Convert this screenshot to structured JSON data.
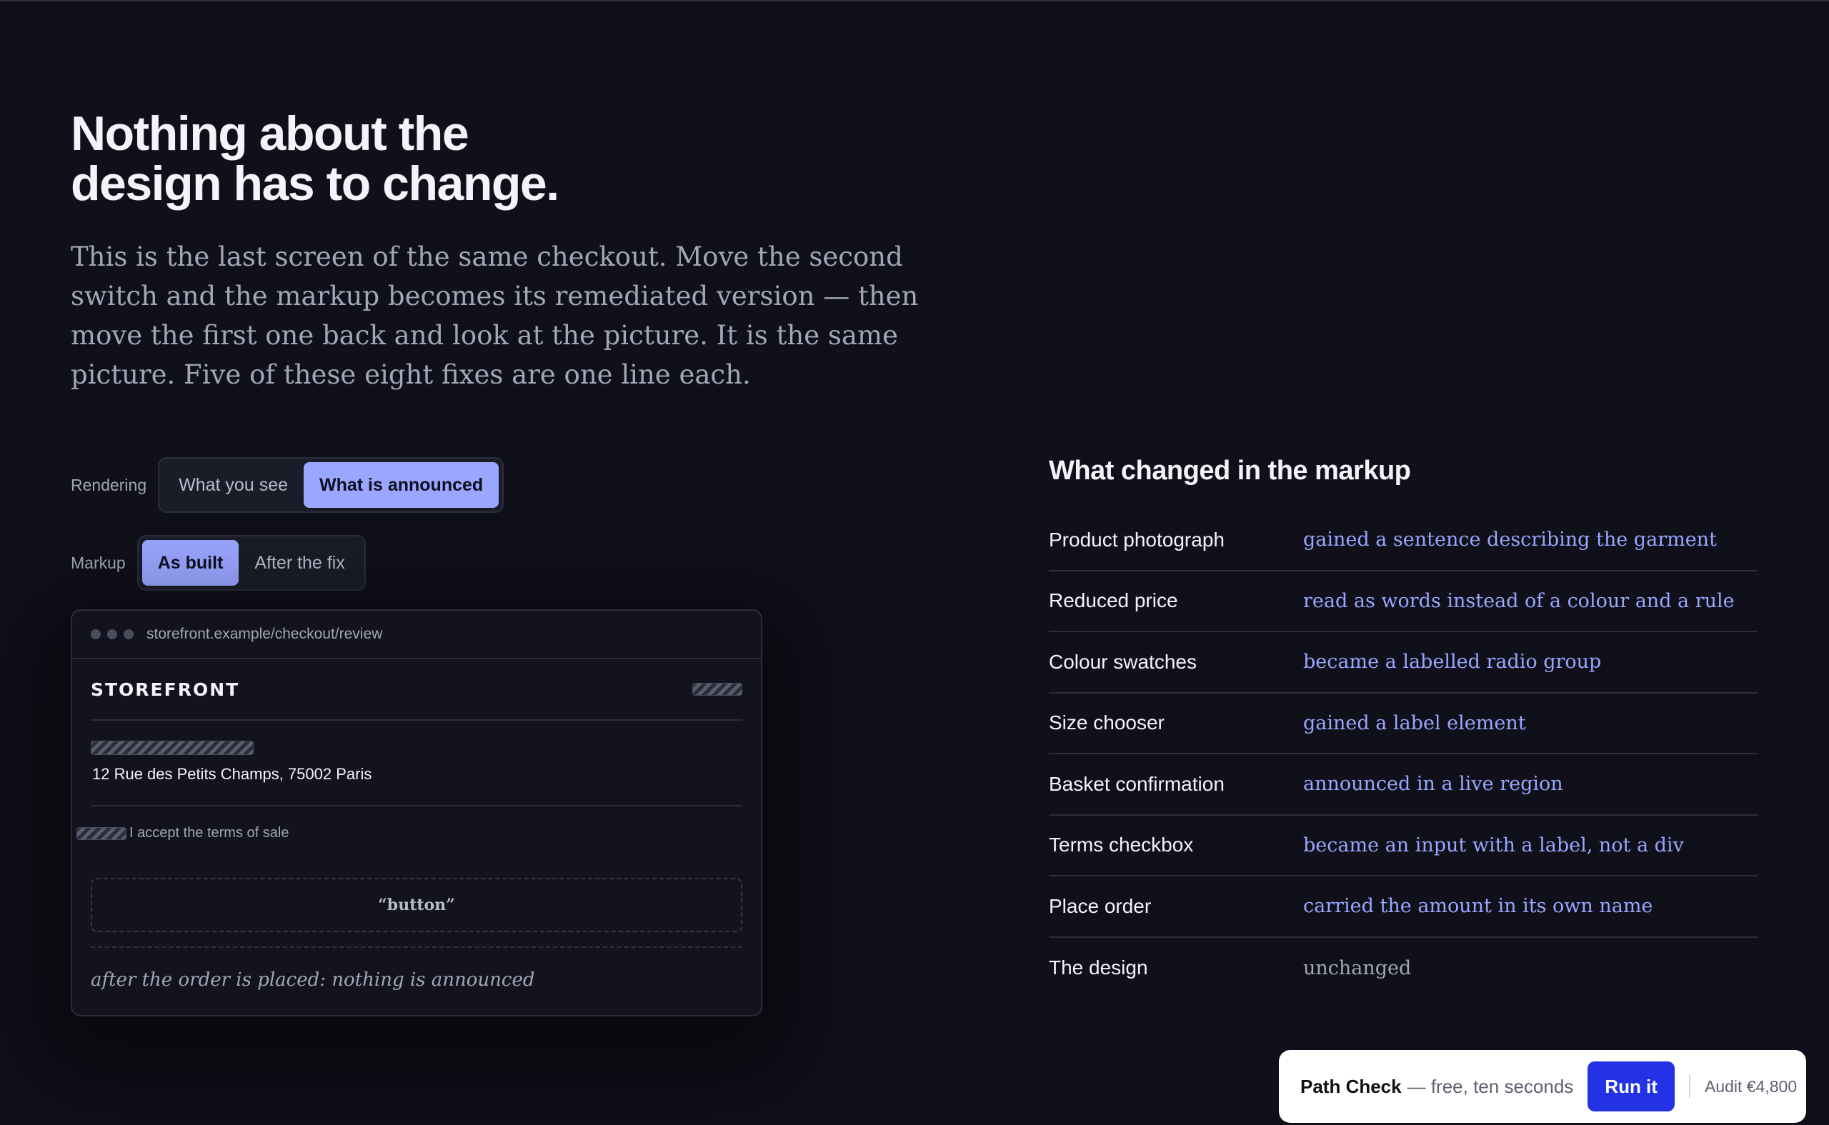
{
  "hero": {
    "title_line1": "Nothing about the",
    "title_line2": "design has to change.",
    "body": "This is the last screen of the same checkout. Move the second switch and the markup becomes its remediated version — then move the first one back and look at the picture. It is the same picture. Five of these eight fixes are one line each."
  },
  "rendering": {
    "label": "Rendering",
    "options": [
      "What you see",
      "What is announced"
    ],
    "selected": "What is announced"
  },
  "markup": {
    "label": "Markup",
    "options": [
      "As built",
      "After the fix"
    ],
    "selected": "As built"
  },
  "preview": {
    "url": "storefront.example/checkout/review",
    "brand": "STOREFRONT",
    "address": "12 Rue des Petits Champs, 75002 Paris",
    "terms_text": "I accept the terms of sale",
    "button_announced": "“button”",
    "announcement": "after the order is placed: nothing is announced"
  },
  "changes": {
    "title": "What changed in the markup",
    "rows": [
      {
        "name": "Product photograph",
        "desc": "gained a sentence describing the garment"
      },
      {
        "name": "Reduced price",
        "desc": "read as words instead of a colour and a rule"
      },
      {
        "name": "Colour swatches",
        "desc": "became a labelled radio group"
      },
      {
        "name": "Size chooser",
        "desc": "gained a label element"
      },
      {
        "name": "Basket confirmation",
        "desc": "announced in a live region"
      },
      {
        "name": "Terms checkbox",
        "desc": "became an input with a label, not a div"
      },
      {
        "name": "Place order",
        "desc": "carried the amount in its own name"
      },
      {
        "name": "The design",
        "desc": "unchanged"
      }
    ]
  },
  "cta": {
    "name": "Path Check",
    "tagline": "— free, ten seconds",
    "button": "Run it",
    "audit": "Audit €4,800"
  },
  "colors": {
    "background": "#0f1019",
    "accent": "#9aa6ff",
    "cta_button": "#2432e6"
  }
}
